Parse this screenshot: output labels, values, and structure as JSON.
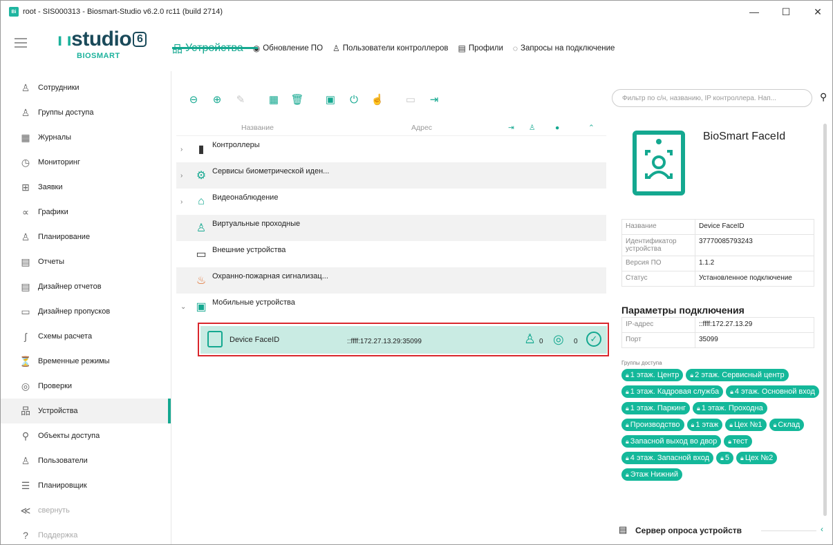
{
  "window": {
    "title": "root - SIS000313 - Biosmart-Studio v6.2.0 rc11 (build 2714)",
    "icon_text": "Bi",
    "min": "—",
    "max": "☐",
    "close": "✕"
  },
  "logo": {
    "bars": "ı ı",
    "main": "studio",
    "version": "6",
    "sub": "BIOSMART"
  },
  "topnav": [
    {
      "label": "Устройства",
      "icon": "devices-icon",
      "glyph": "品"
    },
    {
      "label": "Обновление ПО",
      "icon": "update-icon",
      "glyph": "◉"
    },
    {
      "label": "Пользователи контроллеров",
      "icon": "user-icon",
      "glyph": "♙"
    },
    {
      "label": "Профили",
      "icon": "profile-icon",
      "glyph": "▤"
    },
    {
      "label": "Запросы на подключение",
      "icon": "request-icon",
      "glyph": "◌"
    }
  ],
  "sidebar": [
    {
      "label": "Сотрудники",
      "glyph": "♙"
    },
    {
      "label": "Группы доступа",
      "glyph": "♙"
    },
    {
      "label": "Журналы",
      "glyph": "▦"
    },
    {
      "label": "Мониторинг",
      "glyph": "◷"
    },
    {
      "label": "Заявки",
      "glyph": "⊞"
    },
    {
      "label": "Графики",
      "glyph": "∝"
    },
    {
      "label": "Планирование",
      "glyph": "♙"
    },
    {
      "label": "Отчеты",
      "glyph": "▤"
    },
    {
      "label": "Дизайнер отчетов",
      "glyph": "▤"
    },
    {
      "label": "Дизайнер пропусков",
      "glyph": "▭"
    },
    {
      "label": "Схемы расчета",
      "glyph": "ʃ"
    },
    {
      "label": "Временные режимы",
      "glyph": "⏳"
    },
    {
      "label": "Проверки",
      "glyph": "◎"
    },
    {
      "label": "Устройства",
      "glyph": "品"
    },
    {
      "label": "Объекты доступа",
      "glyph": "⚲"
    },
    {
      "label": "Пользователи",
      "glyph": "♙"
    },
    {
      "label": "Планировщик",
      "glyph": "☰"
    },
    {
      "label": "свернуть",
      "glyph": "≪"
    },
    {
      "label": "Поддержка",
      "glyph": "?"
    }
  ],
  "toolbar": [
    {
      "icon": "zoom-out-icon",
      "glyph": "⊖",
      "enabled": true
    },
    {
      "icon": "add-icon",
      "glyph": "⊕",
      "enabled": true
    },
    {
      "icon": "edit-icon",
      "glyph": "✎",
      "enabled": false
    },
    {
      "icon": "assign-icon",
      "glyph": "▦",
      "enabled": true
    },
    {
      "icon": "delete-icon",
      "glyph": "🗑",
      "enabled": true
    },
    {
      "icon": "face-icon",
      "glyph": "▣",
      "enabled": true
    },
    {
      "icon": "power-icon",
      "glyph": "⏻",
      "enabled": true
    },
    {
      "icon": "hand-icon",
      "glyph": "☝",
      "enabled": false
    },
    {
      "icon": "card-icon",
      "glyph": "▭",
      "enabled": false
    },
    {
      "icon": "export-icon",
      "glyph": "⇥",
      "enabled": true
    }
  ],
  "grid": {
    "headers": {
      "name": "Название",
      "address": "Адрес",
      "h1": "⇥",
      "h2": "♙",
      "h3": "●",
      "h4": "⌃"
    },
    "rows": [
      {
        "label": "Контроллеры",
        "icon": "controller-icon",
        "glyph": "▮",
        "color": "#333",
        "expand": "›"
      },
      {
        "label": "Сервисы биометрической иден...",
        "icon": "biometric-service-icon",
        "glyph": "⚙",
        "color": "#14a890",
        "expand": "›"
      },
      {
        "label": "Видеонаблюдение",
        "icon": "camera-icon",
        "glyph": "⌂",
        "color": "#14a890",
        "expand": "›"
      },
      {
        "label": "Виртуальные проходные",
        "icon": "virtual-pass-icon",
        "glyph": "♙",
        "color": "#14a890",
        "expand": ""
      },
      {
        "label": "Внешние устройства",
        "icon": "external-devices-icon",
        "glyph": "▭",
        "color": "#333",
        "expand": ""
      },
      {
        "label": "Охранно-пожарная сигнализац...",
        "icon": "fire-alarm-icon",
        "glyph": "♨",
        "color": "#e07030",
        "expand": ""
      },
      {
        "label": "Мобильные устройства",
        "icon": "mobile-device-icon",
        "glyph": "▣",
        "color": "#14a890",
        "expand": "⌄"
      }
    ],
    "selected": {
      "name": "Device FaceID",
      "address": "::ffff:172.27.13.29:35099",
      "users": "0",
      "fingerprints": "0"
    }
  },
  "search": {
    "placeholder": "Фильтр по с/н, названию, IP контроллера. Нап...",
    "icon": "⚲"
  },
  "details": {
    "title": "BioSmart FaceId",
    "props": [
      {
        "k": "Название",
        "v": "Device FaceID"
      },
      {
        "k": "Идентификатор устройства",
        "v": "37770085793243"
      },
      {
        "k": "Версия ПО",
        "v": "1.1.2"
      },
      {
        "k": "Статус",
        "v": "Установленное подключение"
      }
    ],
    "conn_title": "Параметры подключения",
    "conn": [
      {
        "k": "IP-адрес",
        "v": "::ffff:172.27.13.29"
      },
      {
        "k": "Порт",
        "v": "35099"
      }
    ],
    "groups_label": "Группы доступа",
    "groups": [
      "1 этаж. Центр",
      "2 этаж. Сервисный центр",
      "1 этаж. Кадровая служба",
      "4 этаж. Основной вход",
      "1 этаж. Паркинг",
      "1 этаж. Проходна",
      "Производство",
      "1 этаж",
      "Цех №1",
      "Склад",
      "Запасной выход во двор",
      "тест",
      "4 этаж. Запасной вход",
      "5",
      "Цех №2",
      "Этаж Нижний"
    ],
    "server_label": "Сервер опроса устройств"
  },
  "colors": {
    "accent": "#14a890",
    "selection": "#c9ebe3",
    "highlight_border": "#d9262c"
  }
}
